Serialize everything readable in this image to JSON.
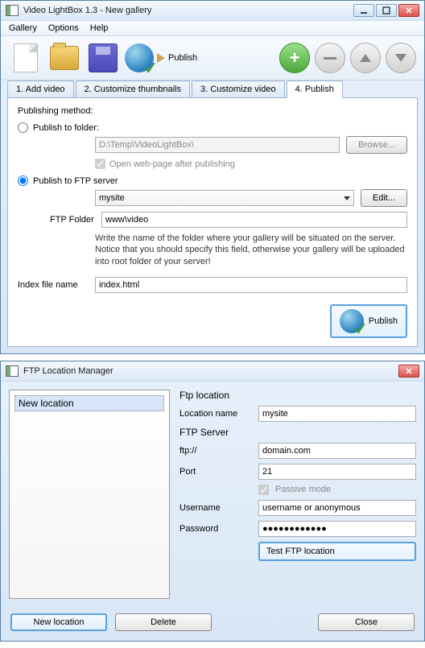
{
  "window1": {
    "title": "Video LightBox 1.3  - New gallery",
    "menu": {
      "gallery": "Gallery",
      "options": "Options",
      "help": "Help"
    },
    "toolbar": {
      "publish": "Publish"
    },
    "tabs": {
      "t1": "1. Add video",
      "t2": "2. Customize thumbnails",
      "t3": "3. Customize video",
      "t4": "4. Publish"
    },
    "panel": {
      "heading": "Publishing method:",
      "folder_label": "Publish to folder:",
      "folder_path": "D:\\Temp\\VideoLightBox\\",
      "browse": "Browse...",
      "open_after": "Open web-page after publishing",
      "ftp_label": "Publish to FTP server",
      "site_value": "mysite",
      "edit": "Edit...",
      "ftp_folder_label": "FTP Folder",
      "ftp_folder_value": "www\\video",
      "help": "Write the name of the folder where your gallery will be situated on the server. Notice that you should specify this field, otherwise your gallery will be uploaded into root folder of your server!",
      "index_label": "Index file name",
      "index_value": "index.html",
      "publish_btn": "Publish"
    }
  },
  "window2": {
    "title": "FTP Location Manager",
    "list_item": "New location",
    "form": {
      "section": "Ftp location",
      "loc_name_label": "Location name",
      "loc_name_value": "mysite",
      "server_section": "FTP Server",
      "ftp_label": "ftp://",
      "ftp_value": "domain.com",
      "port_label": "Port",
      "port_value": "21",
      "passive": "Passive mode",
      "user_label": "Username",
      "user_value": "username or anonymous",
      "pass_label": "Password",
      "pass_value": "●●●●●●●●●●●●",
      "test": "Test FTP location"
    },
    "buttons": {
      "new": "New location",
      "delete": "Delete",
      "close": "Close"
    }
  }
}
